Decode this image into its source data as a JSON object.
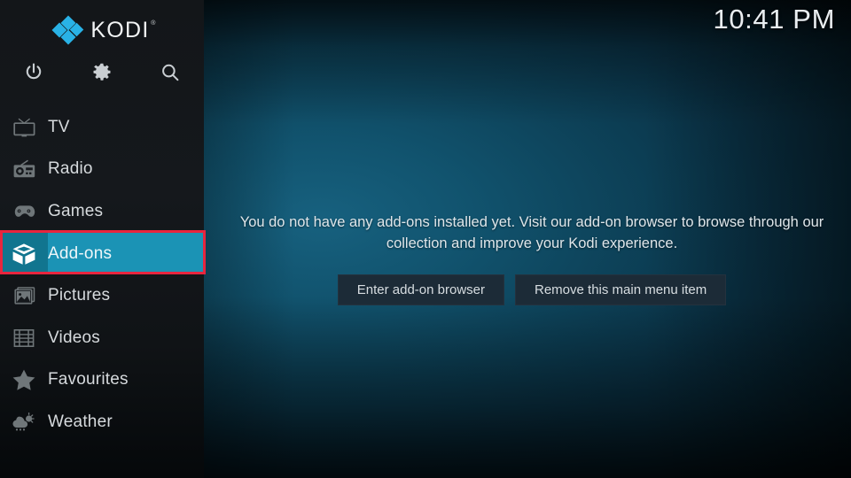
{
  "app": {
    "name": "KODI",
    "trademark": "®",
    "logo_color": "#29b2e6"
  },
  "clock": {
    "time": "10:41 PM"
  },
  "sidebar": {
    "quick_actions": [
      {
        "name": "power-icon",
        "label": "Power"
      },
      {
        "name": "gear-icon",
        "label": "Settings"
      },
      {
        "name": "search-icon",
        "label": "Search"
      }
    ],
    "items": [
      {
        "label": "TV",
        "icon": "tv-icon",
        "selected": false
      },
      {
        "label": "Radio",
        "icon": "radio-icon",
        "selected": false
      },
      {
        "label": "Games",
        "icon": "gamepad-icon",
        "selected": false
      },
      {
        "label": "Add-ons",
        "icon": "addon-box-icon",
        "selected": true
      },
      {
        "label": "Pictures",
        "icon": "pictures-icon",
        "selected": false
      },
      {
        "label": "Videos",
        "icon": "film-icon",
        "selected": false
      },
      {
        "label": "Favourites",
        "icon": "star-icon",
        "selected": false
      },
      {
        "label": "Weather",
        "icon": "weather-icon",
        "selected": false
      }
    ],
    "selected_highlight_color": "#1b93b5",
    "annotation_color": "#e8253e"
  },
  "main": {
    "empty_message": "You do not have any add-ons installed yet. Visit our add-on browser to browse through our collection and improve your Kodi experience.",
    "buttons": [
      {
        "label": "Enter add-on browser"
      },
      {
        "label": "Remove this main menu item"
      }
    ]
  }
}
